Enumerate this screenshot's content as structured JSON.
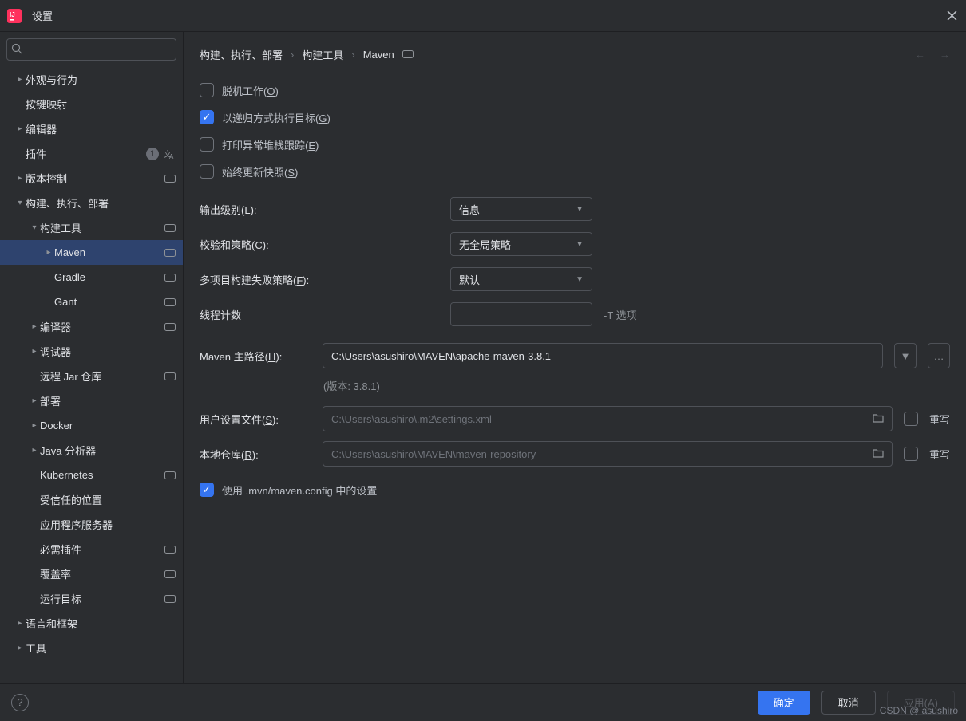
{
  "window": {
    "title": "设置"
  },
  "sidebar": {
    "search_placeholder": "",
    "items": [
      {
        "label": "外观与行为",
        "expand": "▸",
        "indent": 1,
        "pill": false
      },
      {
        "label": "按键映射",
        "expand": "",
        "indent": 1,
        "pill": false
      },
      {
        "label": "编辑器",
        "expand": "▸",
        "indent": 1,
        "pill": false
      },
      {
        "label": "插件",
        "expand": "",
        "indent": 1,
        "pill": false,
        "badge": "1",
        "lang": true
      },
      {
        "label": "版本控制",
        "expand": "▸",
        "indent": 1,
        "pill": true
      },
      {
        "label": "构建、执行、部署",
        "expand": "▾",
        "indent": 1,
        "pill": false
      },
      {
        "label": "构建工具",
        "expand": "▾",
        "indent": 2,
        "pill": true
      },
      {
        "label": "Maven",
        "expand": "▸",
        "indent": 3,
        "pill": true,
        "selected": true
      },
      {
        "label": "Gradle",
        "expand": "",
        "indent": 3,
        "pill": true
      },
      {
        "label": "Gant",
        "expand": "",
        "indent": 3,
        "pill": true
      },
      {
        "label": "编译器",
        "expand": "▸",
        "indent": 2,
        "pill": true
      },
      {
        "label": "调试器",
        "expand": "▸",
        "indent": 2,
        "pill": false
      },
      {
        "label": "远程 Jar 仓库",
        "expand": "",
        "indent": 2,
        "pill": true
      },
      {
        "label": "部署",
        "expand": "▸",
        "indent": 2,
        "pill": false
      },
      {
        "label": "Docker",
        "expand": "▸",
        "indent": 2,
        "pill": false
      },
      {
        "label": "Java 分析器",
        "expand": "▸",
        "indent": 2,
        "pill": false
      },
      {
        "label": "Kubernetes",
        "expand": "",
        "indent": 2,
        "pill": true
      },
      {
        "label": "受信任的位置",
        "expand": "",
        "indent": 2,
        "pill": false
      },
      {
        "label": "应用程序服务器",
        "expand": "",
        "indent": 2,
        "pill": false
      },
      {
        "label": "必需插件",
        "expand": "",
        "indent": 2,
        "pill": true
      },
      {
        "label": "覆盖率",
        "expand": "",
        "indent": 2,
        "pill": true
      },
      {
        "label": "运行目标",
        "expand": "",
        "indent": 2,
        "pill": true
      },
      {
        "label": "语言和框架",
        "expand": "▸",
        "indent": 1,
        "pill": false
      },
      {
        "label": "工具",
        "expand": "▸",
        "indent": 1,
        "pill": false
      }
    ]
  },
  "breadcrumb": {
    "a": "构建、执行、部署",
    "b": "构建工具",
    "c": "Maven"
  },
  "form": {
    "chk_offline": "脱机工作(",
    "chk_offline_u": "O",
    "chk_offline_b": ")",
    "chk_recursive": "以递归方式执行目标(",
    "chk_recursive_u": "G",
    "chk_recursive_b": ")",
    "chk_print": "打印异常堆栈跟踪(",
    "chk_print_u": "E",
    "chk_print_b": ")",
    "chk_snapshot": "始终更新快照(",
    "chk_snapshot_u": "S",
    "chk_snapshot_b": ")",
    "output_label_a": "输出级别(",
    "output_label_u": "L",
    "output_label_b": "):",
    "output_value": "信息",
    "checksum_label_a": "校验和策略(",
    "checksum_label_u": "C",
    "checksum_label_b": "):",
    "checksum_value": "无全局策略",
    "multi_label_a": "多项目构建失败策略(",
    "multi_label_u": "F",
    "multi_label_b": "):",
    "multi_value": "默认",
    "thread_label": "线程计数",
    "thread_value": "",
    "thread_hint": "-T 选项",
    "home_label_a": "Maven 主路径(",
    "home_label_u": "H",
    "home_label_b": "):",
    "home_value": "C:\\Users\\asushiro\\MAVEN\\apache-maven-3.8.1",
    "version_note": "(版本: 3.8.1)",
    "user_settings_label_a": "用户设置文件(",
    "user_settings_label_u": "S",
    "user_settings_label_b": "):",
    "user_settings_value": "C:\\Users\\asushiro\\.m2\\settings.xml",
    "override_label": "重写",
    "local_repo_label_a": "本地仓库(",
    "local_repo_label_u": "R",
    "local_repo_label_b": "):",
    "local_repo_value": "C:\\Users\\asushiro\\MAVEN\\maven-repository",
    "chk_mvn_config": "使用 .mvn/maven.config 中的设置"
  },
  "footer": {
    "ok": "确定",
    "cancel": "取消",
    "apply": "应用(A)"
  },
  "watermark": "CSDN @ asushiro"
}
